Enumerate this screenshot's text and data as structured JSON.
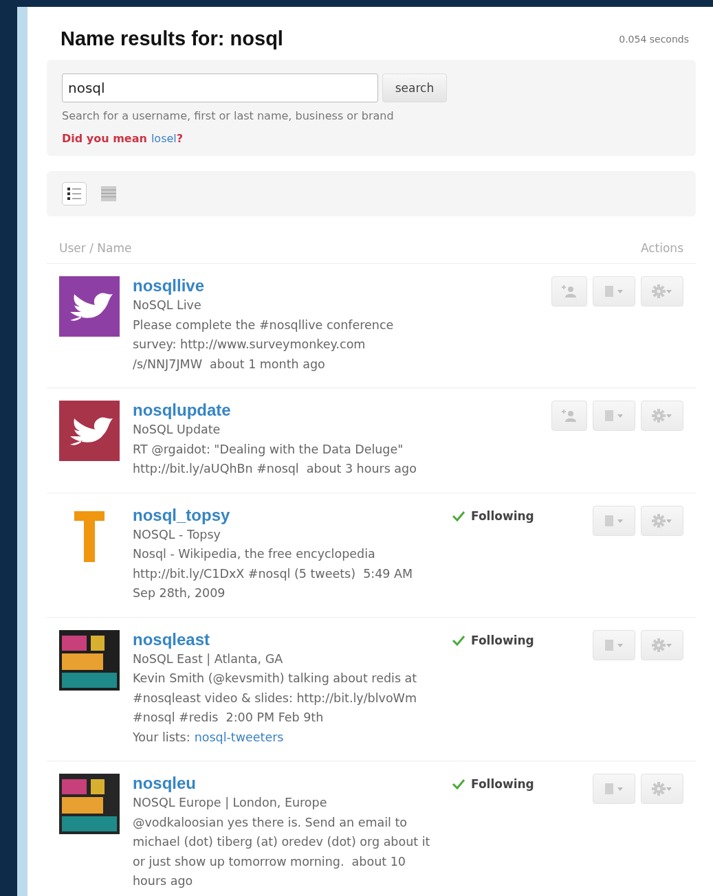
{
  "header": {
    "title": "Name results for: nosql",
    "timing": "0.054 seconds"
  },
  "search": {
    "value": "nosql",
    "button": "search",
    "hint": "Search for a username, first or last name, business or brand",
    "suggestion_prefix": "Did you mean",
    "suggestion": "losel",
    "suggestion_suffix": "?"
  },
  "view_modes": [
    {
      "kind": "list",
      "selected": true
    },
    {
      "kind": "grid",
      "selected": false
    }
  ],
  "columns": {
    "user": "User / Name",
    "actions": "Actions"
  },
  "results": [
    {
      "avatar": {
        "kind": "bird",
        "color": "#8e3fa3"
      },
      "username": "nosqllive",
      "full_name": "NoSQL Live",
      "tweet": "Please complete the #nosqllive conference survey: http://www.surveymonkey.com /s/NNJ7JMW",
      "time": "about 1 month ago",
      "following": false
    },
    {
      "avatar": {
        "kind": "bird",
        "color": "#a8344a"
      },
      "username": "nosqlupdate",
      "full_name": "NoSQL Update",
      "tweet": "RT @rgaidot: \"Dealing with the Data Deluge\" http://bit.ly/aUQhBn #nosql",
      "time": "about 3 hours ago",
      "following": false
    },
    {
      "avatar": {
        "kind": "letter",
        "color": "#f0960f"
      },
      "username": "nosql_topsy",
      "full_name": "NOSQL - Topsy",
      "tweet": "Nosql - Wikipedia, the free encyclopedia http://bit.ly/C1DxX #nosql (5 tweets)",
      "time": "5:49 AM Sep 28th, 2009",
      "following": true,
      "following_label": "Following"
    },
    {
      "avatar": {
        "kind": "tiles",
        "color": "#1f1f1f"
      },
      "username": "nosqleast",
      "full_name": "NoSQL East | Atlanta, GA",
      "tweet": "Kevin Smith (@kevsmith) talking about redis at #nosqleast video & slides: http://bit.ly/blvoWm #nosql #redis",
      "time": "2:00 PM Feb 9th",
      "following": true,
      "following_label": "Following",
      "lists_label": "Your lists:",
      "lists": "nosql-tweeters"
    },
    {
      "avatar": {
        "kind": "tiles",
        "color": "#262626"
      },
      "username": "nosqleu",
      "full_name": "NOSQL Europe | London, Europe",
      "tweet": "@vodkaloosian yes there is. Send an email to michael (dot) tiberg (at) oredev (dot) org about it or just show up tomorrow morning.",
      "time": "about 10 hours ago",
      "following": true,
      "following_label": "Following"
    }
  ]
}
